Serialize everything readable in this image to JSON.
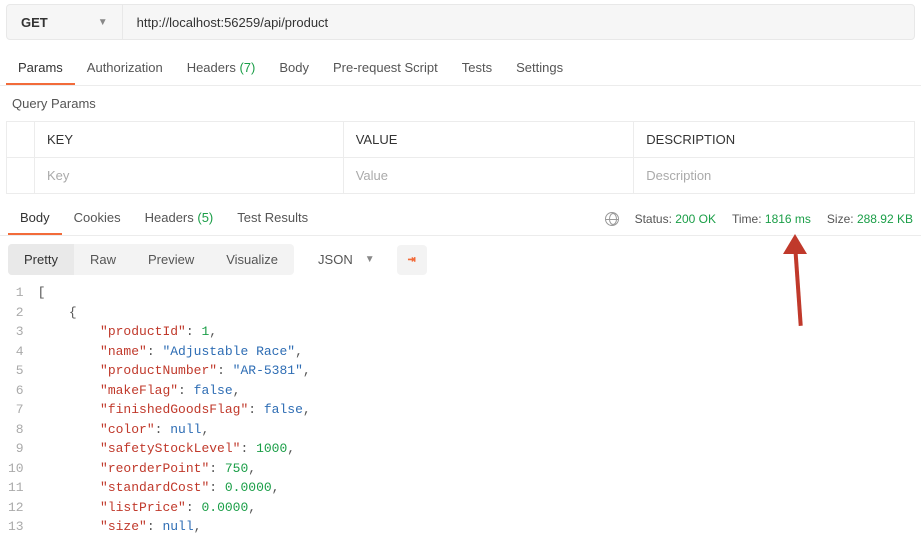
{
  "request": {
    "method": "GET",
    "url": "http://localhost:56259/api/product"
  },
  "reqTabs": {
    "params": "Params",
    "authorization": "Authorization",
    "headers_label": "Headers",
    "headers_count": "(7)",
    "body": "Body",
    "prerequest": "Pre-request Script",
    "tests": "Tests",
    "settings": "Settings"
  },
  "queryParams": {
    "title": "Query Params",
    "headers": {
      "key": "KEY",
      "value": "VALUE",
      "description": "DESCRIPTION"
    },
    "placeholders": {
      "key": "Key",
      "value": "Value",
      "description": "Description"
    }
  },
  "respTabs": {
    "body": "Body",
    "cookies": "Cookies",
    "headers_label": "Headers",
    "headers_count": "(5)",
    "testResults": "Test Results"
  },
  "respStatus": {
    "status_label": "Status:",
    "status_value": "200 OK",
    "time_label": "Time:",
    "time_value": "1816 ms",
    "size_label": "Size:",
    "size_value": "288.92 KB"
  },
  "viewTabs": {
    "pretty": "Pretty",
    "raw": "Raw",
    "preview": "Preview",
    "visualize": "Visualize"
  },
  "formatSelect": "JSON",
  "response": {
    "product": {
      "productId": 1,
      "name": "Adjustable Race",
      "productNumber": "AR-5381",
      "makeFlag": false,
      "finishedGoodsFlag": false,
      "color": null,
      "safetyStockLevel": 1000,
      "reorderPoint": 750,
      "standardCost": "0.0000",
      "listPrice": "0.0000",
      "size": null
    }
  }
}
